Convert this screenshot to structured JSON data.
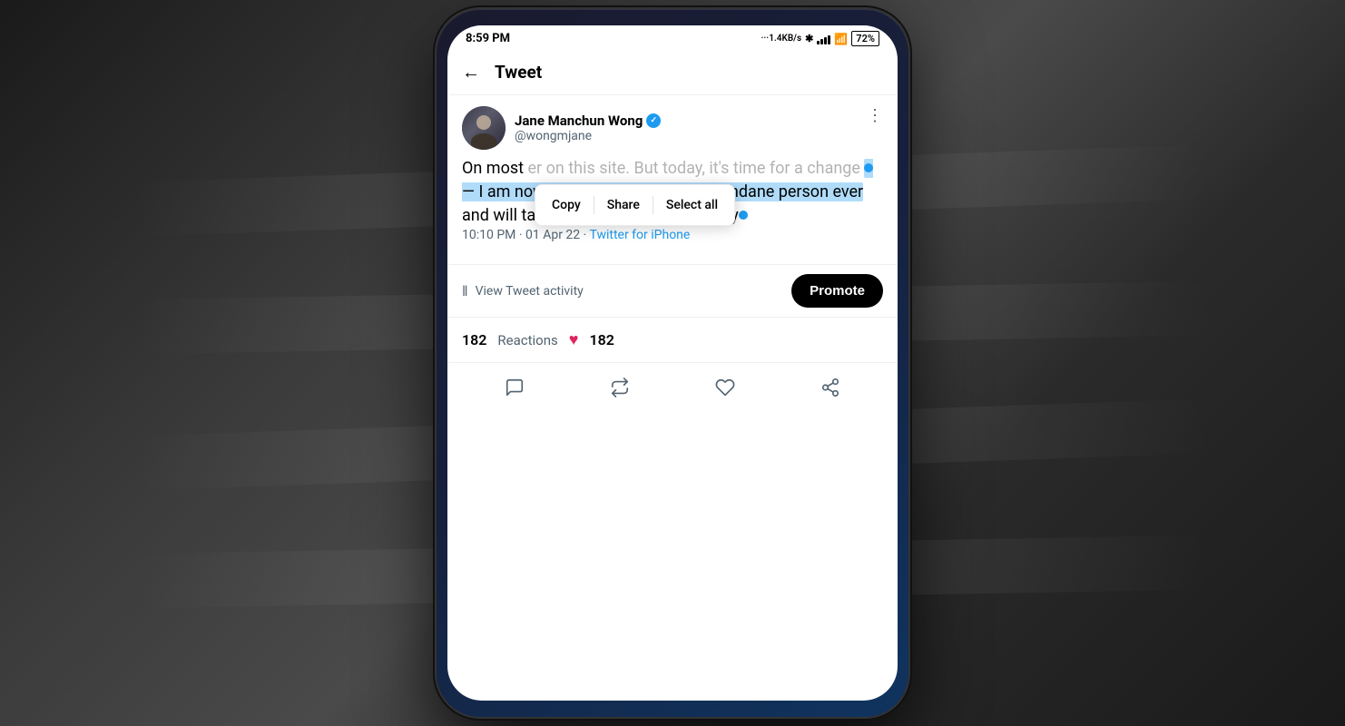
{
  "background": {
    "color": "#2a2a2a"
  },
  "phone": {
    "status_bar": {
      "time": "8:59 PM",
      "network_info": "···1.4KB/s",
      "battery": "72"
    },
    "header": {
      "back_label": "←",
      "title": "Tweet"
    },
    "tweet": {
      "user": {
        "name": "Jane Manchun Wong",
        "handle": "@wongmjane",
        "verified": true
      },
      "text_before": "On most",
      "text_hidden1": "er on this site. But today, it's time for a change",
      "text_highlighted": "— I am now the most serious and mundane person ever",
      "text_after": " and will take every single thing literally",
      "timestamp": "10:10 PM · 01 Apr 22 · ",
      "source": "Twitter for iPhone",
      "reactions_count": "182",
      "reactions_label": "Reactions",
      "likes_count": "182"
    },
    "selection_popup": {
      "copy_label": "Copy",
      "share_label": "Share",
      "select_all_label": "Select all"
    },
    "activity": {
      "view_label": "View Tweet activity"
    },
    "promote": {
      "label": "Promote"
    }
  }
}
